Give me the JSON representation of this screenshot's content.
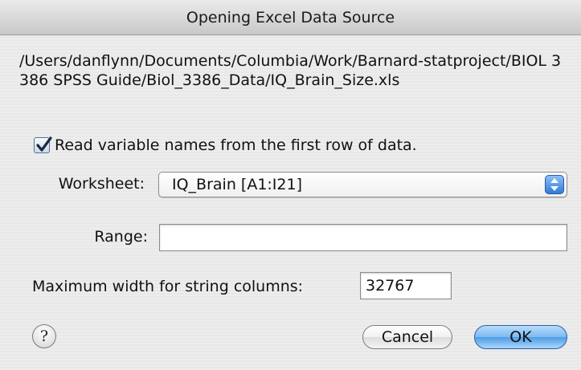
{
  "dialog": {
    "title": "Opening Excel Data Source",
    "file_path": "/Users/danflynn/Documents/Columbia/Work/Barnard-statproject/BIOL 3386 SPSS Guide/Biol_3386_Data/IQ_Brain_Size.xls",
    "read_names_label": "Read variable names from the first row of data.",
    "read_names_checked": true,
    "worksheet_label": "Worksheet:",
    "worksheet_value": "IQ_Brain  [A1:I21]",
    "range_label": "Range:",
    "range_value": "",
    "max_width_label": "Maximum width for string columns:",
    "max_width_value": "32767",
    "help_label": "?",
    "cancel_label": "Cancel",
    "ok_label": "OK"
  },
  "icons": {
    "checkbox": "checkmark-icon",
    "select": "up-down-arrows-icon",
    "help": "help-icon"
  },
  "colors": {
    "accent": "#4f9ce6",
    "checkmark": "#1a2a40"
  }
}
